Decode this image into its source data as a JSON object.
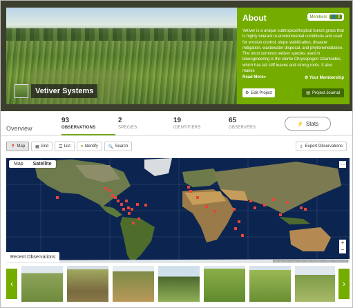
{
  "project": {
    "name": "Vetiver Systems"
  },
  "about": {
    "title": "About",
    "members_label": "Members",
    "members_count": "3",
    "description": "Vetiver is a unique subtropical/tropical bunch grass that is highly tolerant to environmental conditions and used for erosion control, slope stabilization, disaster mitigation, wastewater disposal, and phytoremediation. The most common vetiver species used in bioengineering is the sterile Chrysopogon zizanioides, which has tall stiff leaves and strong roots. It also makes",
    "read_more": "Read More»",
    "membership": "Your Membership",
    "edit_project": "Edit Project",
    "project_journal": "Project Journal"
  },
  "tabs": {
    "overview": "Overview",
    "observations": {
      "num": "93",
      "label": "OBSERVATIONS"
    },
    "species": {
      "num": "2",
      "label": "SPECIES"
    },
    "identifiers": {
      "num": "19",
      "label": "IDENTIFIERS"
    },
    "observers": {
      "num": "65",
      "label": "OBSERVERS"
    },
    "stats": "Stats"
  },
  "toolbar": {
    "map": "Map",
    "grid": "Grid",
    "list": "List",
    "identify": "Identify",
    "search": "Search",
    "export": "Export Observations"
  },
  "map": {
    "map_label": "Map",
    "satellite_label": "Satellite",
    "zoom_in": "+",
    "zoom_out": "−",
    "credit": "Map data ©2017 Imagery ©2017 NASA, TerraMetrics | 2000 km | Terms of Use"
  },
  "recent": {
    "title": "Recent Observations"
  },
  "colors": {
    "accent": "#74ac00",
    "marker": "#e8453c"
  }
}
